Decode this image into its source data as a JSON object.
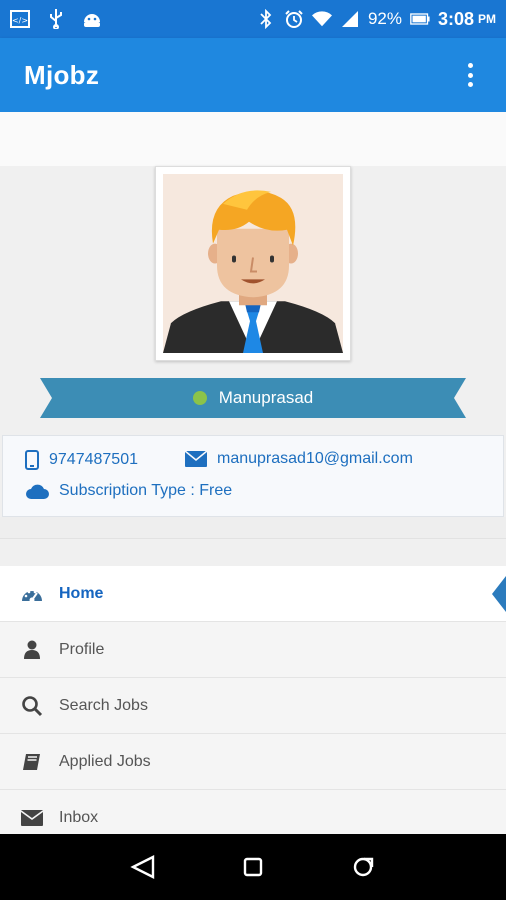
{
  "status_bar": {
    "battery": "92%",
    "time": "3:08",
    "ampm": "PM"
  },
  "app_bar": {
    "title": "Mjobz"
  },
  "profile": {
    "name": "Manuprasad",
    "online": true,
    "status_color": "#8bc34a"
  },
  "contact": {
    "phone": "9747487501",
    "email": "manuprasad10@gmail.com",
    "subscription": "Subscription Type : Free"
  },
  "menu": {
    "items": [
      {
        "label": "Home",
        "icon": "dashboard-icon",
        "active": true
      },
      {
        "label": "Profile",
        "icon": "person-icon",
        "active": false
      },
      {
        "label": "Search Jobs",
        "icon": "search-icon",
        "active": false
      },
      {
        "label": "Applied Jobs",
        "icon": "book-icon",
        "active": false
      },
      {
        "label": "Inbox",
        "icon": "envelope-icon",
        "active": false
      }
    ]
  },
  "colors": {
    "status_bar": "#1976d2",
    "app_bar": "#1f88e0",
    "ribbon": "#3c8db5",
    "accent_text": "#1e6fbf"
  }
}
